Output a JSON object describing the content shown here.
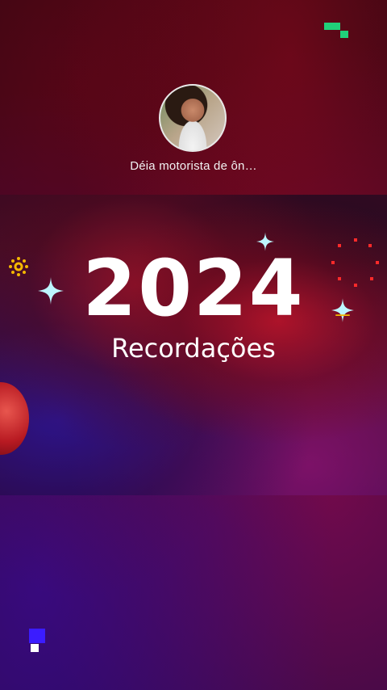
{
  "profile": {
    "username": "Déia motorista de ôn…"
  },
  "story": {
    "year": "2024",
    "title": "Recordações"
  },
  "colors": {
    "accent_green": "#21d07a",
    "accent_blue": "#3b1cff",
    "sparkle_cyan": "#bdf6ff",
    "firework_red": "#ff2a2a",
    "sun_yellow": "#f5b800"
  },
  "icons": {
    "top_logo": "pixel-logo-icon",
    "bottom_logo": "pixel-logo-icon",
    "sparkles": "sparkle-icon",
    "sun": "sun-icon",
    "firework": "firework-icon",
    "heart": "heart-icon"
  }
}
